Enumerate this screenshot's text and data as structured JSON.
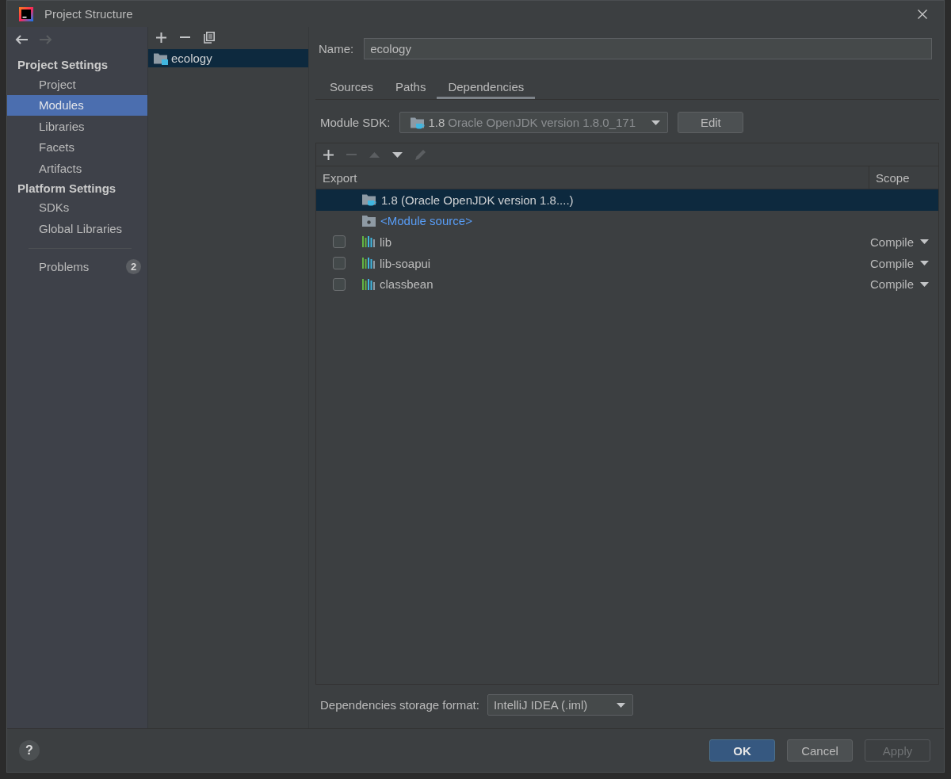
{
  "window": {
    "title": "Project Structure"
  },
  "navigation": [
    {
      "kind": "back",
      "disabled": false
    },
    {
      "kind": "forward",
      "disabled": true
    }
  ],
  "sidebar": {
    "groups": [
      {
        "heading": "Project Settings",
        "items": [
          {
            "label": "Project",
            "selected": false
          },
          {
            "label": "Modules",
            "selected": true
          },
          {
            "label": "Libraries",
            "selected": false
          },
          {
            "label": "Facets",
            "selected": false
          },
          {
            "label": "Artifacts",
            "selected": false
          }
        ]
      },
      {
        "heading": "Platform Settings",
        "items": [
          {
            "label": "SDKs",
            "selected": false
          },
          {
            "label": "Global Libraries",
            "selected": false
          }
        ]
      }
    ],
    "problems": {
      "label": "Problems",
      "count": "2",
      "selected": false
    }
  },
  "modules": {
    "toolbar": [
      {
        "kind": "add",
        "disabled": false
      },
      {
        "kind": "remove",
        "disabled": false
      },
      {
        "kind": "copy",
        "disabled": false
      }
    ],
    "items": [
      {
        "label": "ecology",
        "selected": true
      }
    ]
  },
  "name_field": {
    "label": "Name:",
    "value": "ecology"
  },
  "tabs": [
    {
      "label": "Sources",
      "selected": false
    },
    {
      "label": "Paths",
      "selected": false
    },
    {
      "label": "Dependencies",
      "selected": true
    }
  ],
  "module_sdk": {
    "label": "Module SDK:",
    "version": "1.8",
    "description": "Oracle OpenJDK version 1.8.0_171",
    "button": "Edit"
  },
  "dependencies": {
    "toolbar": [
      {
        "kind": "add",
        "disabled": false
      },
      {
        "kind": "remove",
        "disabled": true
      },
      {
        "kind": "move_up",
        "disabled": true
      },
      {
        "kind": "move_down",
        "disabled": false
      },
      {
        "kind": "edit",
        "disabled": true
      }
    ],
    "columns": [
      "Export",
      "Scope"
    ],
    "rows": [
      {
        "kind": "sdk",
        "label": "1.8 (Oracle OpenJDK version 1.8....)",
        "selected": true
      },
      {
        "kind": "source",
        "label": "<Module source>",
        "selected": false
      },
      {
        "kind": "library",
        "label": "lib",
        "checked": false,
        "scope": "Compile",
        "selected": false
      },
      {
        "kind": "library",
        "label": "lib-soapui",
        "checked": false,
        "scope": "Compile",
        "selected": false
      },
      {
        "kind": "library",
        "label": "classbean",
        "checked": false,
        "scope": "Compile",
        "selected": false
      }
    ]
  },
  "storage_format": {
    "label": "Dependencies storage format:",
    "value": "IntelliJ IDEA (.iml)"
  },
  "help_button": "?",
  "buttons": [
    {
      "label": "OK",
      "kind": "default",
      "disabled": false
    },
    {
      "label": "Cancel",
      "kind": "normal",
      "disabled": false
    },
    {
      "label": "Apply",
      "kind": "normal",
      "disabled": true
    }
  ]
}
